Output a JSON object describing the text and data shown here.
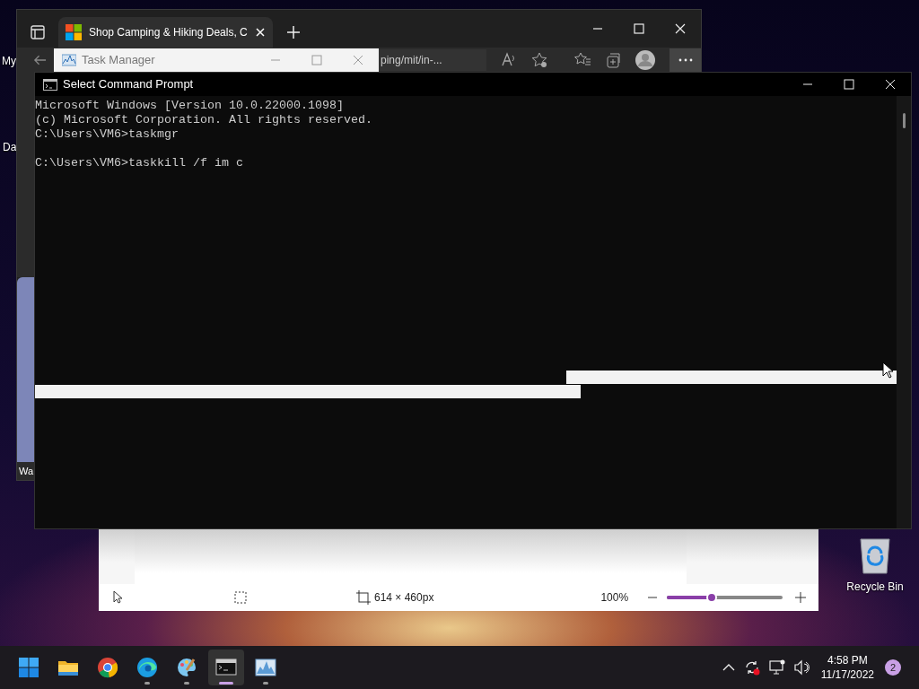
{
  "desktop": {
    "icons": [
      {
        "label": "My"
      },
      {
        "label": "Da"
      }
    ],
    "recycle_bin": {
      "label": "Recycle Bin"
    }
  },
  "browser": {
    "tab": {
      "title": "Shop Camping & Hiking Deals, C",
      "selected": true
    },
    "address": "ping/mit/in-...",
    "side_panel": {
      "label": "Wa"
    }
  },
  "task_manager": {
    "title": "Task Manager"
  },
  "cmd": {
    "title": "Select Command Prompt",
    "selection": true,
    "lines": [
      {
        "text": "Microsoft Windows [Version 10.0.22000.1098]",
        "gap_before": false
      },
      {
        "text": "(c) Microsoft Corporation. All rights reserved.",
        "gap_before": false
      },
      {
        "text": "C:\\Users\\VM6>taskmgr",
        "gap_before": false
      },
      {
        "text": "C:\\Users\\VM6>taskkill /f im c",
        "gap_before": true
      }
    ]
  },
  "paint": {
    "size": "614 × 460px",
    "zoom": "100%",
    "zoom_slider": {
      "level": 0.39
    }
  },
  "taskbar": {
    "apps": [
      {
        "kind": "start",
        "running": false,
        "selected": false
      },
      {
        "kind": "explorer",
        "running": false,
        "selected": false
      },
      {
        "kind": "chrome",
        "running": false,
        "selected": false
      },
      {
        "kind": "edge",
        "running": true,
        "selected": false
      },
      {
        "kind": "paint",
        "running": true,
        "selected": false
      },
      {
        "kind": "terminal",
        "running": true,
        "selected": true
      },
      {
        "kind": "taskmanager",
        "running": true,
        "selected": false
      }
    ],
    "clock": {
      "time": "4:58 PM",
      "date": "11/17/2022"
    },
    "notifications": "2"
  }
}
